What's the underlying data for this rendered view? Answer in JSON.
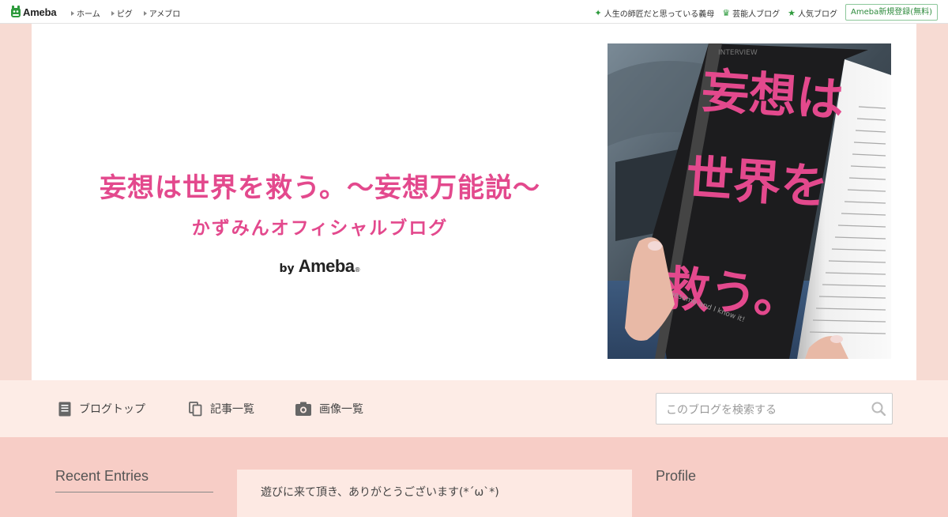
{
  "topbar": {
    "logo": "Ameba",
    "nav": [
      "ホーム",
      "ピグ",
      "アメブロ"
    ],
    "right": [
      {
        "icon": "sparkle-icon",
        "label": "人生の師匠だと思っている義母"
      },
      {
        "icon": "crown-icon",
        "label": "芸能人ブログ"
      },
      {
        "icon": "star-icon",
        "label": "人気ブログ"
      }
    ],
    "signup": "Ameba新規登録(無料)"
  },
  "header": {
    "title": "妄想は世界を救う。～妄想万能説～",
    "subtitle": "かずみんオフィシャルブログ",
    "by": "by",
    "brand": "Ameba",
    "brand_mark": "®",
    "image": {
      "tag": "INTERVIEW",
      "headline_lines": [
        "妄想は",
        "世界を",
        "救う。"
      ],
      "caption": "I'm awesome and I know it!"
    }
  },
  "nav": {
    "items": [
      {
        "icon": "document-icon",
        "label": "ブログトップ"
      },
      {
        "icon": "copy-icon",
        "label": "記事一覧"
      },
      {
        "icon": "camera-icon",
        "label": "画像一覧"
      }
    ],
    "search_placeholder": "このブログを検索する"
  },
  "content": {
    "recent_entries_heading": "Recent Entries",
    "welcome_text": "遊びに来て頂き、ありがとうございます(*´ω`*)",
    "profile_heading": "Profile"
  },
  "colors": {
    "accent_pink": "#e3498d",
    "page_bg": "#f7cdc6",
    "nav_bg": "#fdece6",
    "ameba_green": "#2d9a3c"
  }
}
